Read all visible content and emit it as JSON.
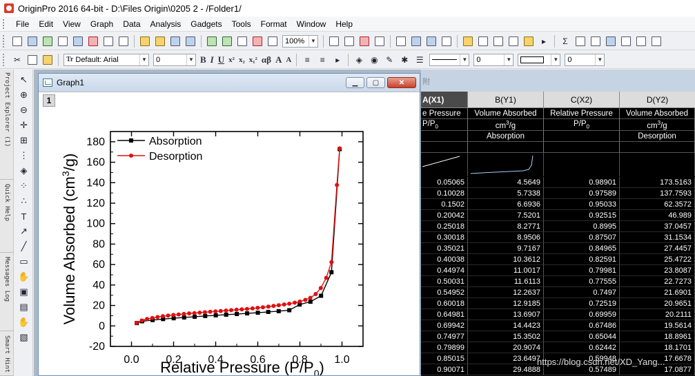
{
  "window": {
    "title": "OriginPro 2016 64-bit - D:\\Files Origin\\0205 2 - /Folder1/"
  },
  "menu": [
    "File",
    "Edit",
    "View",
    "Graph",
    "Data",
    "Analysis",
    "Gadgets",
    "Tools",
    "Format",
    "Window",
    "Help"
  ],
  "toolbar": {
    "zoom": "100%",
    "font_name": "Default: Arial",
    "font_size": "0",
    "line_width_value": "0",
    "fill_value": "0",
    "tt_label": "Tr",
    "format_glyphs": [
      "B",
      "I",
      "U",
      "x²",
      "x₂",
      "x₁²",
      "αβ",
      "A",
      "A"
    ]
  },
  "left_dock": {
    "tabs": [
      "Project Explorer (1)",
      "Quick Help",
      "Messages Log",
      "Smart Hint"
    ]
  },
  "graph_window": {
    "title": "Graph1",
    "layer_number": "1"
  },
  "chart_data": {
    "type": "line",
    "xlabel": "Relative Pressure (P/P",
    "xlabel_sub": "0",
    "xlabel_close": ")",
    "ylabel": "Volume Absorbed (cm",
    "ylabel_sup": "3",
    "ylabel_close": "/g)",
    "xlim": [
      -0.1,
      1.1
    ],
    "ylim": [
      -20,
      190
    ],
    "xticks": [
      0.0,
      0.2,
      0.4,
      0.6,
      0.8,
      1.0
    ],
    "xtick_labels": [
      "0.0",
      "0.2",
      "0.4",
      "0.6",
      "0.8",
      "1.0"
    ],
    "yticks": [
      -20,
      0,
      20,
      40,
      60,
      80,
      100,
      120,
      140,
      160,
      180
    ],
    "ytick_labels": [
      "-20",
      "0",
      "20",
      "40",
      "60",
      "80",
      "100",
      "120",
      "140",
      "160",
      "180"
    ],
    "legend_position": "top-left",
    "series": [
      {
        "name": "Absorption",
        "color": "#000000",
        "marker": "square",
        "x": [
          0.0254,
          0.05065,
          0.10028,
          0.1502,
          0.20042,
          0.25018,
          0.30018,
          0.35021,
          0.40038,
          0.44974,
          0.50031,
          0.54952,
          0.60018,
          0.64981,
          0.69942,
          0.74977,
          0.79899,
          0.85015,
          0.90071,
          0.95,
          0.98901
        ],
        "y": [
          2.8,
          4.5649,
          5.7338,
          6.6936,
          7.5201,
          8.2771,
          8.9506,
          9.7167,
          10.3612,
          11.0017,
          11.6113,
          12.2637,
          12.9185,
          13.6907,
          14.4423,
          15.3502,
          20.9074,
          23.6497,
          29.4888,
          52.5,
          172.8
        ]
      },
      {
        "name": "Desorption",
        "color": "#e01010",
        "marker": "circle",
        "x": [
          0.98901,
          0.97589,
          0.95033,
          0.92515,
          0.8995,
          0.87507,
          0.84965,
          0.82591,
          0.79981,
          0.77555,
          0.7497,
          0.72519,
          0.69959,
          0.67486,
          0.65044,
          0.62442,
          0.59948,
          0.57489,
          0.549,
          0.524,
          0.499,
          0.474,
          0.449,
          0.424,
          0.399,
          0.374,
          0.349,
          0.324,
          0.299,
          0.274,
          0.249,
          0.224,
          0.199,
          0.174,
          0.149,
          0.124,
          0.099,
          0.074,
          0.049,
          0.024
        ],
        "y": [
          173.5163,
          137.7593,
          62.3572,
          46.989,
          37.0457,
          31.1534,
          27.4457,
          25.4722,
          23.8087,
          22.7273,
          21.6901,
          20.9651,
          20.2111,
          19.5614,
          18.8961,
          18.1701,
          17.6678,
          17.0877,
          16.6,
          16.2,
          15.8,
          15.4,
          15.0,
          14.6,
          14.2,
          13.8,
          13.4,
          13.0,
          12.6,
          12.2,
          11.7,
          11.2,
          10.7,
          10.1,
          9.5,
          8.7,
          7.8,
          6.8,
          5.3,
          3.0
        ]
      }
    ]
  },
  "worksheet": {
    "columns": [
      {
        "head": "A(X1)",
        "long_name": "e Pressure",
        "units": "P/P0",
        "comment": ""
      },
      {
        "head": "B(Y1)",
        "long_name": "Volume Absorbed",
        "units": "cm3/g",
        "comment": "Absorption"
      },
      {
        "head": "C(X2)",
        "long_name": "Relative Pressure",
        "units": "P/P0",
        "comment": ""
      },
      {
        "head": "D(Y2)",
        "long_name": "Volume Absorbed",
        "units": "cm3/g",
        "comment": "Desorption"
      }
    ],
    "rows": [
      [
        "0.05065",
        "4.5649",
        "0.98901",
        "173.5163"
      ],
      [
        "0.10028",
        "5.7338",
        "0.97589",
        "137.7593"
      ],
      [
        "0.1502",
        "6.6936",
        "0.95033",
        "62.3572"
      ],
      [
        "0.20042",
        "7.5201",
        "0.92515",
        "46.989"
      ],
      [
        "0.25018",
        "8.2771",
        "0.8995",
        "37.0457"
      ],
      [
        "0.30018",
        "8.9506",
        "0.87507",
        "31.1534"
      ],
      [
        "0.35021",
        "9.7167",
        "0.84965",
        "27.4457"
      ],
      [
        "0.40038",
        "10.3612",
        "0.82591",
        "25.4722"
      ],
      [
        "0.44974",
        "11.0017",
        "0.79981",
        "23.8087"
      ],
      [
        "0.50031",
        "11.6113",
        "0.77555",
        "22.7273"
      ],
      [
        "0.54952",
        "12.2637",
        "0.7497",
        "21.6901"
      ],
      [
        "0.60018",
        "12.9185",
        "0.72519",
        "20.9651"
      ],
      [
        "0.64981",
        "13.6907",
        "0.69959",
        "20.2111"
      ],
      [
        "0.69942",
        "14.4423",
        "0.67486",
        "19.5614"
      ],
      [
        "0.74977",
        "15.3502",
        "0.65044",
        "18.8961"
      ],
      [
        "0.79899",
        "20.9074",
        "0.62442",
        "18.1701"
      ],
      [
        "0.85015",
        "23.6497",
        "0.59948",
        "17.6678"
      ],
      [
        "0.90071",
        "29.4888",
        "0.57489",
        "17.0877"
      ]
    ]
  },
  "watermark": "https://blog.csdn.net/XD_Yang..."
}
